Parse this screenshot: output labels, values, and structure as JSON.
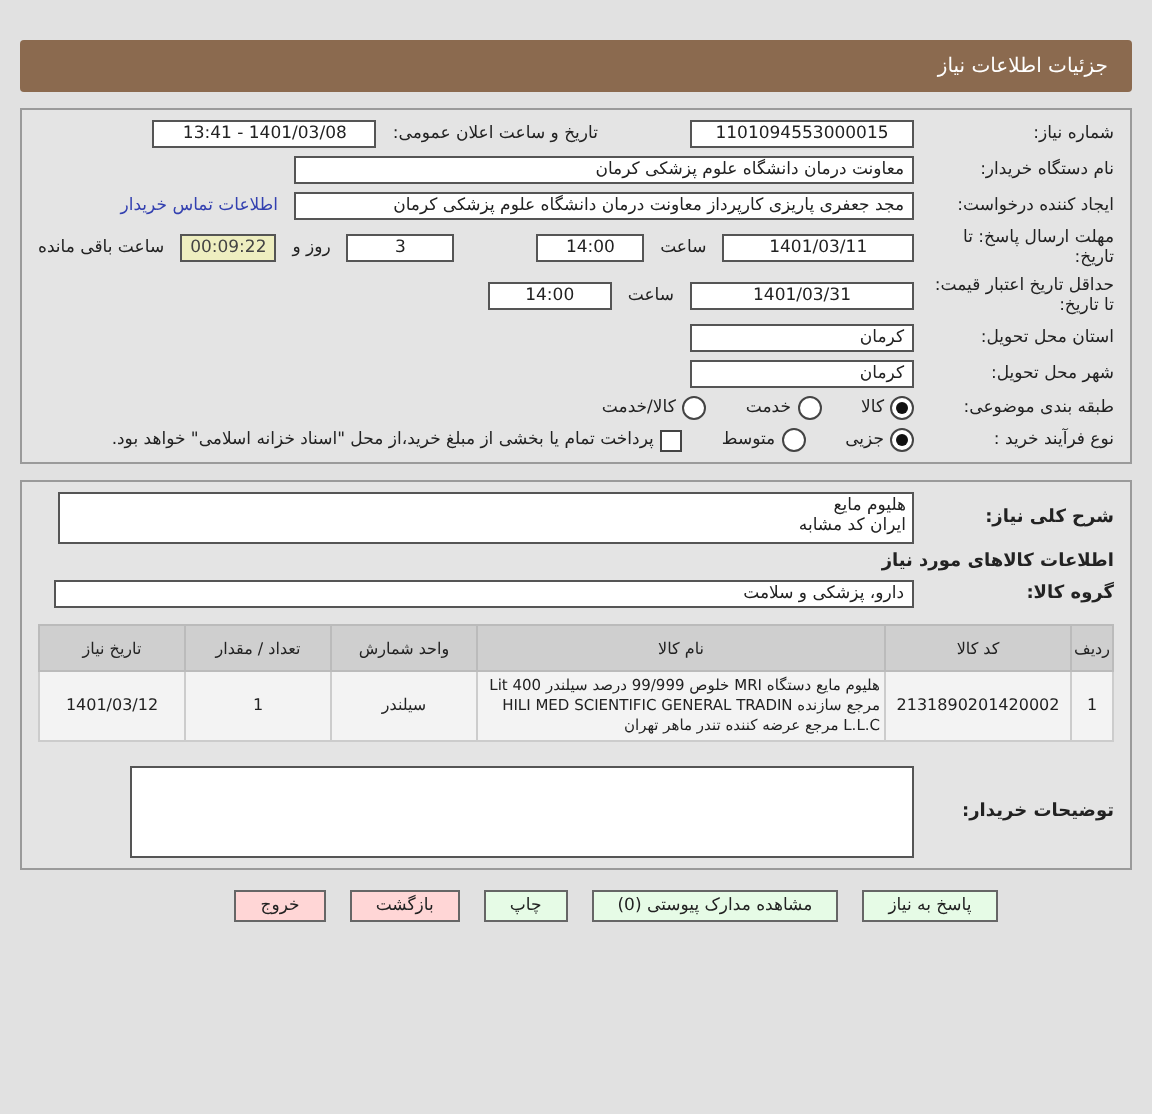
{
  "header": {
    "title": "جزئیات اطلاعات نیاز"
  },
  "need_number": {
    "label": "شماره نیاز:",
    "value": "1101094553000015"
  },
  "announce": {
    "label": "تاریخ و ساعت اعلان عمومی:",
    "value": "1401/03/08 - 13:41"
  },
  "buyer": {
    "label": "نام دستگاه خریدار:",
    "value": "معاونت درمان دانشگاه علوم پزشکی کرمان"
  },
  "creator": {
    "label": "ایجاد کننده درخواست:",
    "value": "مجد جعفری پاریزی کارپرداز معاونت درمان دانشگاه علوم پزشکی کرمان",
    "link": "اطلاعات تماس خریدار"
  },
  "deadline": {
    "label": "مهلت ارسال پاسخ: تا تاریخ:",
    "date": "1401/03/11",
    "time_label": "ساعت",
    "time": "14:00",
    "days": "3",
    "days_label": "روز و",
    "remaining": "00:09:22",
    "remaining_label": "ساعت باقی مانده"
  },
  "validity": {
    "label": "حداقل تاریخ اعتبار قیمت: تا تاریخ:",
    "date": "1401/03/31",
    "time_label": "ساعت",
    "time": "14:00"
  },
  "province": {
    "label": "استان محل تحویل:",
    "value": "کرمان"
  },
  "city": {
    "label": "شهر محل تحویل:",
    "value": "کرمان"
  },
  "category": {
    "label": "طبقه بندی موضوعی:",
    "options": [
      {
        "label": "کالا",
        "selected": true
      },
      {
        "label": "خدمت",
        "selected": false
      },
      {
        "label": "کالا/خدمت",
        "selected": false
      }
    ]
  },
  "process": {
    "label": "نوع فرآیند خرید :",
    "options": [
      {
        "label": "جزیی",
        "selected": true
      },
      {
        "label": "متوسط",
        "selected": false
      }
    ],
    "checkbox": {
      "label": "پرداخت تمام یا بخشی از مبلغ خرید،از محل \"اسناد خزانه اسلامی\" خواهد بود.",
      "checked": false
    }
  },
  "description": {
    "label": "شرح کلی نیاز:",
    "value": "هلیوم مایع\nایران کد مشابه"
  },
  "goods_title": "اطلاعات کالاهای مورد نیاز",
  "goods_group": {
    "label": "گروه کالا:",
    "value": "دارو، پزشکی و سلامت"
  },
  "table": {
    "columns": [
      "ردیف",
      "کد کالا",
      "نام کالا",
      "واحد شمارش",
      "تعداد / مقدار",
      "تاریخ نیاز"
    ],
    "rows": [
      [
        "1",
        "2131890201420002",
        "هلیوم مایع دستگاه MRI خلوص 99/999 درصد سیلندر 400 Lit\nمرجع سازنده HILI MED SCIENTIFIC GENERAL TRADIN\nL.L.C مرجع عرضه کننده تندر ماهر تهران",
        "سیلندر",
        "1",
        "1401/03/12"
      ]
    ]
  },
  "buyer_notes": {
    "label": "توضیحات خریدار:"
  },
  "buttons": [
    {
      "label": "پاسخ به نیاز",
      "kind": "green"
    },
    {
      "label": "مشاهده مدارک پیوستی (0)",
      "kind": "green"
    },
    {
      "label": "چاپ",
      "kind": "green"
    },
    {
      "label": "بازگشت",
      "kind": "red"
    },
    {
      "label": "خروج",
      "kind": "red"
    }
  ]
}
